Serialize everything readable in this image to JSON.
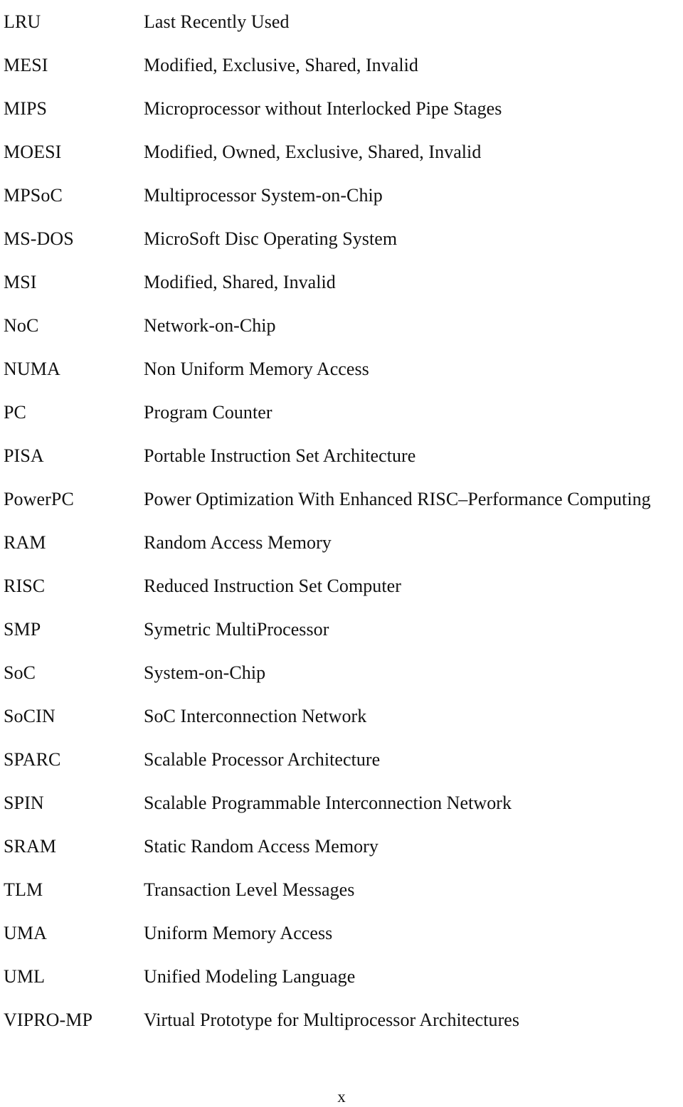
{
  "document": {
    "type": "list-of-abbreviations",
    "text_color": "#111111",
    "background_color": "#ffffff"
  },
  "abbreviations": [
    {
      "term": "LRU",
      "definition": "Last Recently Used"
    },
    {
      "term": "MESI",
      "definition": "Modified, Exclusive, Shared, Invalid"
    },
    {
      "term": "MIPS",
      "definition": "Microprocessor without Interlocked Pipe Stages"
    },
    {
      "term": "MOESI",
      "definition": "Modified, Owned, Exclusive, Shared, Invalid"
    },
    {
      "term": "MPSoC",
      "definition": "Multiprocessor System-on-Chip"
    },
    {
      "term": "MS-DOS",
      "definition": "MicroSoft Disc Operating System"
    },
    {
      "term": "MSI",
      "definition": "Modified, Shared, Invalid"
    },
    {
      "term": "NoC",
      "definition": "Network-on-Chip"
    },
    {
      "term": "NUMA",
      "definition": "Non Uniform Memory Access"
    },
    {
      "term": "PC",
      "definition": "Program Counter"
    },
    {
      "term": "PISA",
      "definition": "Portable Instruction Set Architecture"
    },
    {
      "term": "PowerPC",
      "definition": "Power Optimization With Enhanced RISC–Performance Computing"
    },
    {
      "term": "RAM",
      "definition": "Random Access Memory"
    },
    {
      "term": "RISC",
      "definition": "Reduced Instruction Set Computer"
    },
    {
      "term": "SMP",
      "definition": "Symetric MultiProcessor"
    },
    {
      "term": "SoC",
      "definition": "System-on-Chip"
    },
    {
      "term": "SoCIN",
      "definition": "SoC Interconnection Network"
    },
    {
      "term": "SPARC",
      "definition": "Scalable Processor Architecture"
    },
    {
      "term": "SPIN",
      "definition": "Scalable Programmable Interconnection Network"
    },
    {
      "term": "SRAM",
      "definition": "Static Random Access Memory"
    },
    {
      "term": "TLM",
      "definition": "Transaction Level Messages"
    },
    {
      "term": "UMA",
      "definition": "Uniform Memory Access"
    },
    {
      "term": "UML",
      "definition": "Unified Modeling Language"
    },
    {
      "term": "VIPRO-MP",
      "definition": "Virtual Prototype for Multiprocessor Architectures"
    }
  ],
  "footer": {
    "page_number": "x"
  }
}
